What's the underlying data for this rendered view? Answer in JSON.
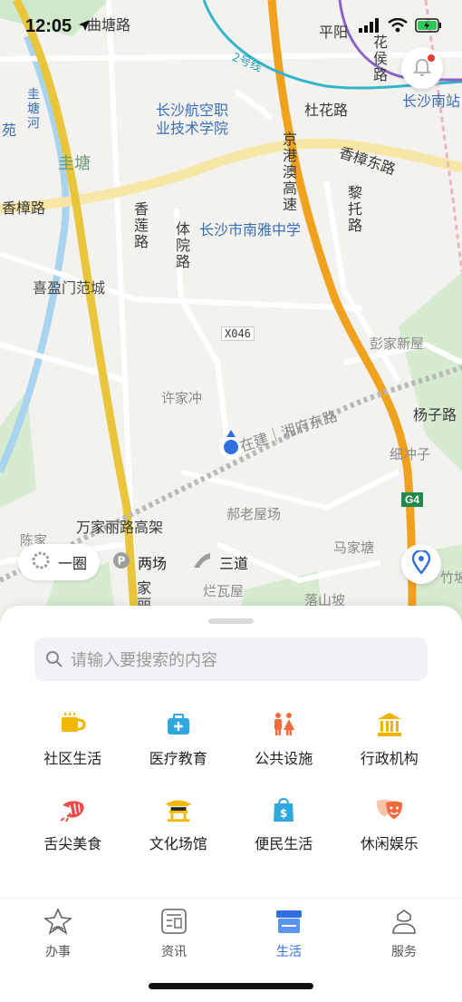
{
  "status_bar": {
    "time": "12:05"
  },
  "map": {
    "labels": {
      "qutang_road": "曲塘路",
      "ping_yang": "平阳",
      "huahou_road": "花侯路",
      "line2": "2号线",
      "changsha_south": "长沙南站",
      "duhua_road": "杜花路",
      "yuan": "苑",
      "gui_tang_river": "圭塘河",
      "gui_tang": "圭塘",
      "college": "长沙航空职业技术学院",
      "expressway": "京港澳高速",
      "xiangzhang_east": "香樟东路",
      "xiangzhang_road": "香樟路",
      "xianglian_road": "香莲路",
      "tiyuan_road": "体院路",
      "nanya": "长沙市南雅中学",
      "lituo_road": "黎托路",
      "xiyingmen": "喜盈门范城",
      "x046": "X046",
      "pengjia": "彭家新屋",
      "xujiachong": "许家冲",
      "xiangfu_east": "在建｜湘府东路",
      "yangzi_road": "杨子路",
      "xichongzi": "细冲子",
      "g4": "G4",
      "chenjia": "陈家",
      "wanjiali": "万家丽路高架",
      "haolao": "郝老屋场",
      "majiatang": "马家塘",
      "jiali": "家丽",
      "lanwawu": "烂瓦屋",
      "luoshanpo": "落山坡",
      "zhuba": "竹坡"
    }
  },
  "legend": {
    "items": [
      {
        "label": "一圈"
      },
      {
        "label": "两场"
      },
      {
        "label": "三道"
      }
    ]
  },
  "search": {
    "placeholder": "请输入要搜索的内容"
  },
  "categories": [
    {
      "label": "社区生活",
      "icon": "cup-icon",
      "color": "#f5b800"
    },
    {
      "label": "医疗教育",
      "icon": "medical-kit-icon",
      "color": "#2fa8e0"
    },
    {
      "label": "公共设施",
      "icon": "restroom-icon",
      "color": "#f26a3d"
    },
    {
      "label": "行政机构",
      "icon": "government-building-icon",
      "color": "#f0b400"
    },
    {
      "label": "舌尖美食",
      "icon": "shrimp-icon",
      "color": "#ee4b4b"
    },
    {
      "label": "文化场馆",
      "icon": "pavilion-icon",
      "color": "#f5b800"
    },
    {
      "label": "便民生活",
      "icon": "shopping-bag-icon",
      "color": "#2fa8e0"
    },
    {
      "label": "休闲娱乐",
      "icon": "theater-mask-icon",
      "color": "#f26a3d"
    }
  ],
  "tabbar": {
    "items": [
      {
        "label": "办事",
        "icon": "star-hand-icon"
      },
      {
        "label": "资讯",
        "icon": "news-icon"
      },
      {
        "label": "生活",
        "icon": "life-icon",
        "active": true
      },
      {
        "label": "服务",
        "icon": "person-service-icon"
      }
    ],
    "active_color": "#2f6fe0"
  }
}
